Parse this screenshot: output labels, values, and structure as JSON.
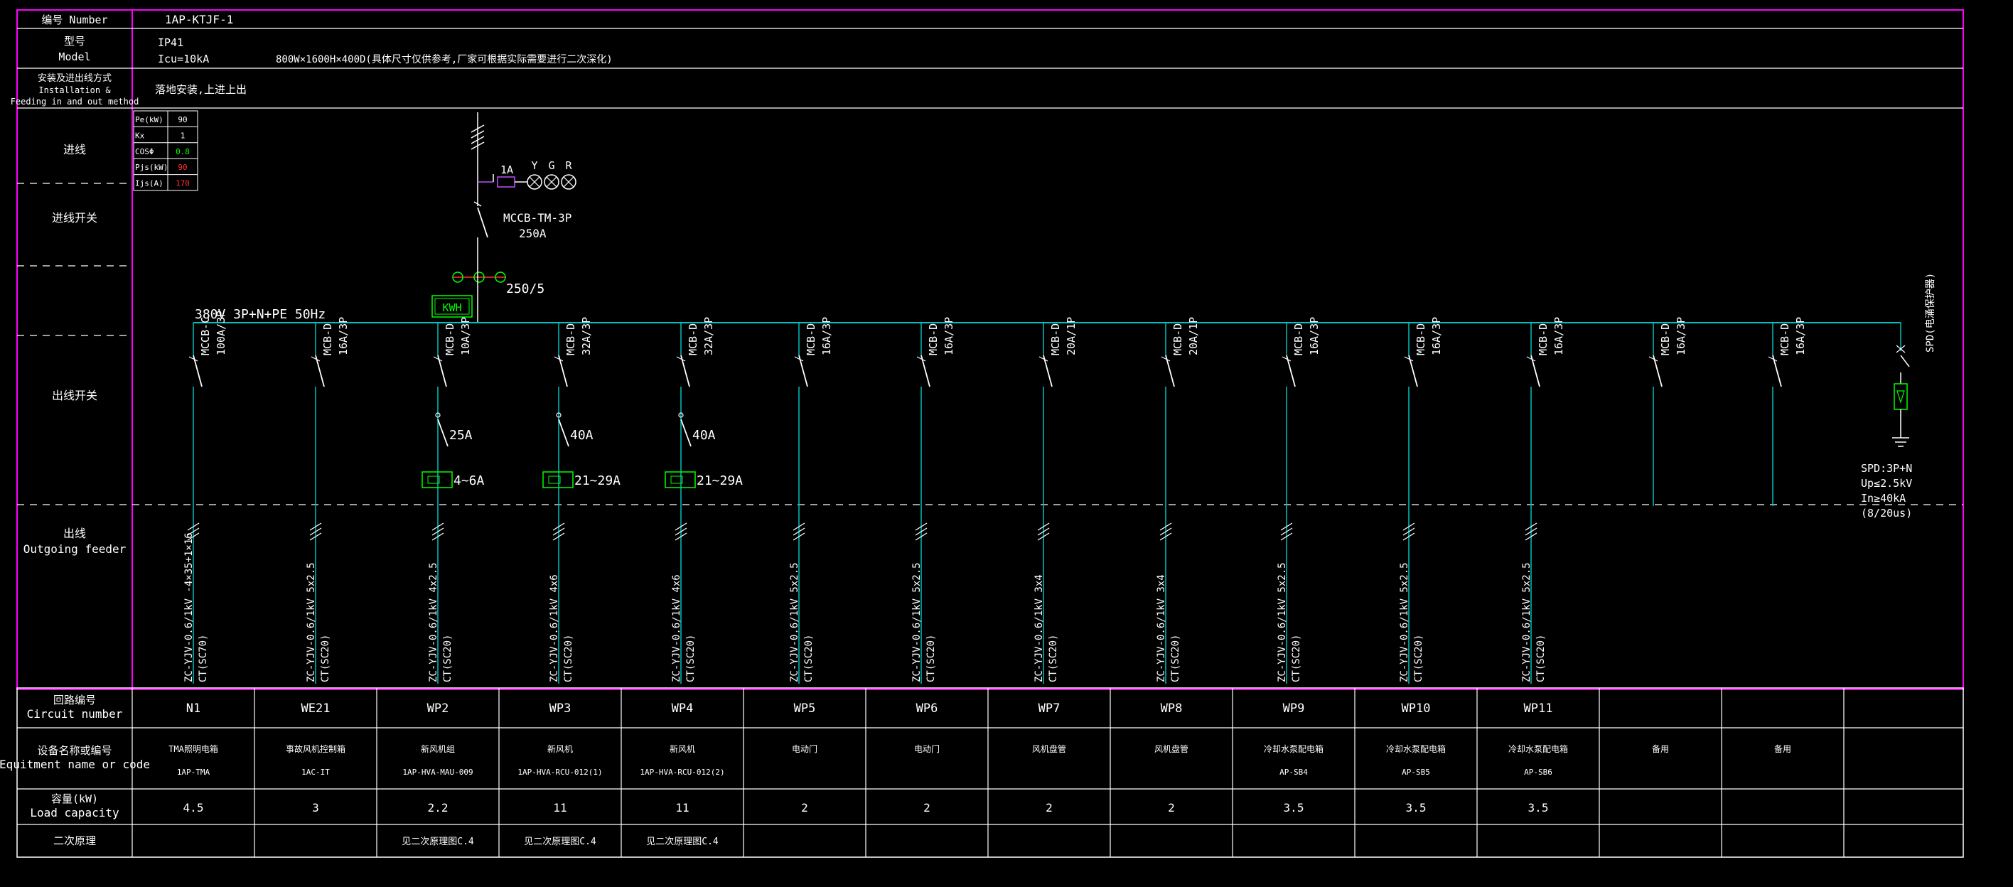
{
  "colors": {
    "frame": "#ff00ff",
    "line": "#ffffff",
    "bus": "#00bfbf",
    "device": "#00ff00",
    "label": "#ffffff",
    "dim": "#cfcfcf",
    "red": "#ff3030"
  },
  "header": {
    "number_label": "编号  Number",
    "number_value": "1AP-KTJF-1",
    "model_label_cn": "型号",
    "model_label_en": "Model",
    "model_ip": "IP41",
    "model_icu": "Icu=10kA",
    "model_size": "800W×1600H×400D(具体尺寸仅供参考,厂家可根据实际需要进行二次深化)",
    "install_label_cn": "安装及进出线方式",
    "install_label_en1": "Installation &",
    "install_label_en2": "Feeding in and out method",
    "install_value": "落地安装,上进上出"
  },
  "rows": {
    "incoming": "进线",
    "incoming_switch": "进线开关",
    "outgoing_switch": "出线开关",
    "feeder_cn": "出线",
    "feeder_en": "Outgoing feeder"
  },
  "load_table": [
    {
      "key": "Pe(kW)",
      "value": "90",
      "color": "#ffffff"
    },
    {
      "key": "Kx",
      "value": "1",
      "color": "#ffffff"
    },
    {
      "key": "COSΦ",
      "value": "0.8",
      "color": "#00ff00"
    },
    {
      "key": "Pjs(kW)",
      "value": "90",
      "color": "#ff3030"
    },
    {
      "key": "Ijs(A)",
      "value": "170",
      "color": "#ff3030"
    }
  ],
  "main": {
    "indicator_fuse": "1A",
    "lamp_labels": [
      "Y",
      "G",
      "R"
    ],
    "breaker_type": "MCCB-TM-3P",
    "breaker_rating": "250A",
    "ct_ratio": "250/5",
    "meter": "KWH",
    "bus_label": "380V  3P+N+PE  50Hz"
  },
  "spd": {
    "label": "SPD(电涌保护器)",
    "spec": [
      "SPD:3P+N",
      "Up≤2.5kV",
      "In≥40kA",
      "(8/20us)"
    ]
  },
  "branches": [
    {
      "breaker": "MCCB-C",
      "rating": "100A/3P",
      "contactor": "",
      "overload": "",
      "cable": "ZC-YJV-0.6/1kV -4×35+1×16",
      "conduit": "CT(SC70)"
    },
    {
      "breaker": "MCB-D",
      "rating": "16A/3P",
      "contactor": "",
      "overload": "",
      "cable": "ZC-YJV-0.6/1kV 5x2.5",
      "conduit": "CT(SC20)"
    },
    {
      "breaker": "MCB-D",
      "rating": "10A/3P",
      "contactor": "25A",
      "overload": "4~6A",
      "cable": "ZC-YJV-0.6/1kV 4x2.5",
      "conduit": "CT(SC20)"
    },
    {
      "breaker": "MCB-D",
      "rating": "32A/3P",
      "contactor": "40A",
      "overload": "21~29A",
      "cable": "ZC-YJV-0.6/1kV 4x6",
      "conduit": "CT(SC20)"
    },
    {
      "breaker": "MCB-D",
      "rating": "32A/3P",
      "contactor": "40A",
      "overload": "21~29A",
      "cable": "ZC-YJV-0.6/1kV 4x6",
      "conduit": "CT(SC20)"
    },
    {
      "breaker": "MCB-D",
      "rating": "16A/3P",
      "contactor": "",
      "overload": "",
      "cable": "ZC-YJV-0.6/1kV 5x2.5",
      "conduit": "CT(SC20)"
    },
    {
      "breaker": "MCB-D",
      "rating": "16A/3P",
      "contactor": "",
      "overload": "",
      "cable": "ZC-YJV-0.6/1kV 5x2.5",
      "conduit": "CT(SC20)"
    },
    {
      "breaker": "MCB-D",
      "rating": "20A/1P",
      "contactor": "",
      "overload": "",
      "cable": "ZC-YJV-0.6/1kV 3x4",
      "conduit": "CT(SC20)"
    },
    {
      "breaker": "MCB-D",
      "rating": "20A/1P",
      "contactor": "",
      "overload": "",
      "cable": "ZC-YJV-0.6/1kV 3x4",
      "conduit": "CT(SC20)"
    },
    {
      "breaker": "MCB-D",
      "rating": "16A/3P",
      "contactor": "",
      "overload": "",
      "cable": "ZC-YJV-0.6/1kV 5x2.5",
      "conduit": "CT(SC20)"
    },
    {
      "breaker": "MCB-D",
      "rating": "16A/3P",
      "contactor": "",
      "overload": "",
      "cable": "ZC-YJV-0.6/1kV 5x2.5",
      "conduit": "CT(SC20)"
    },
    {
      "breaker": "MCB-D",
      "rating": "16A/3P",
      "contactor": "",
      "overload": "",
      "cable": "ZC-YJV-0.6/1kV 5x2.5",
      "conduit": "CT(SC20)"
    },
    {
      "breaker": "MCB-D",
      "rating": "16A/3P",
      "contactor": "",
      "overload": "",
      "cable": "",
      "conduit": ""
    },
    {
      "breaker": "MCB-D",
      "rating": "16A/3P",
      "contactor": "",
      "overload": "",
      "cable": "",
      "conduit": ""
    }
  ],
  "bottom_table": {
    "row_labels": [
      {
        "cn": "回路编号",
        "en": "Circuit number"
      },
      {
        "cn": "设备名称或编号",
        "en": "Equitment name or code"
      },
      {
        "cn": "容量(kW)",
        "en": "Load capacity"
      },
      {
        "cn": "二次原理",
        "en": ""
      }
    ],
    "circuits": [
      "N1",
      "WE21",
      "WP2",
      "WP3",
      "WP4",
      "WP5",
      "WP6",
      "WP7",
      "WP8",
      "WP9",
      "WP10",
      "WP11",
      "",
      "",
      ""
    ],
    "equipment_names": [
      "TMA照明电箱",
      "事故风机控制箱",
      "新风机组",
      "新风机",
      "新风机",
      "电动门",
      "电动门",
      "风机盘管",
      "风机盘管",
      "冷却水泵配电箱",
      "冷却水泵配电箱",
      "冷却水泵配电箱",
      "备用",
      "备用",
      ""
    ],
    "equipment_codes": [
      "1AP-TMA",
      "1AC-IT",
      "1AP-HVA-MAU-009",
      "1AP-HVA-RCU-012(1)",
      "1AP-HVA-RCU-012(2)",
      "",
      "",
      "",
      "",
      "AP-SB4",
      "AP-SB5",
      "AP-SB6",
      "",
      "",
      ""
    ],
    "capacities": [
      "4.5",
      "3",
      "2.2",
      "11",
      "11",
      "2",
      "2",
      "2",
      "2",
      "3.5",
      "3.5",
      "3.5",
      "",
      "",
      ""
    ],
    "secondary": [
      "",
      "",
      "见二次原理图C.4",
      "见二次原理图C.4",
      "见二次原理图C.4",
      "",
      "",
      "",
      "",
      "",
      "",
      "",
      "",
      "",
      ""
    ]
  }
}
